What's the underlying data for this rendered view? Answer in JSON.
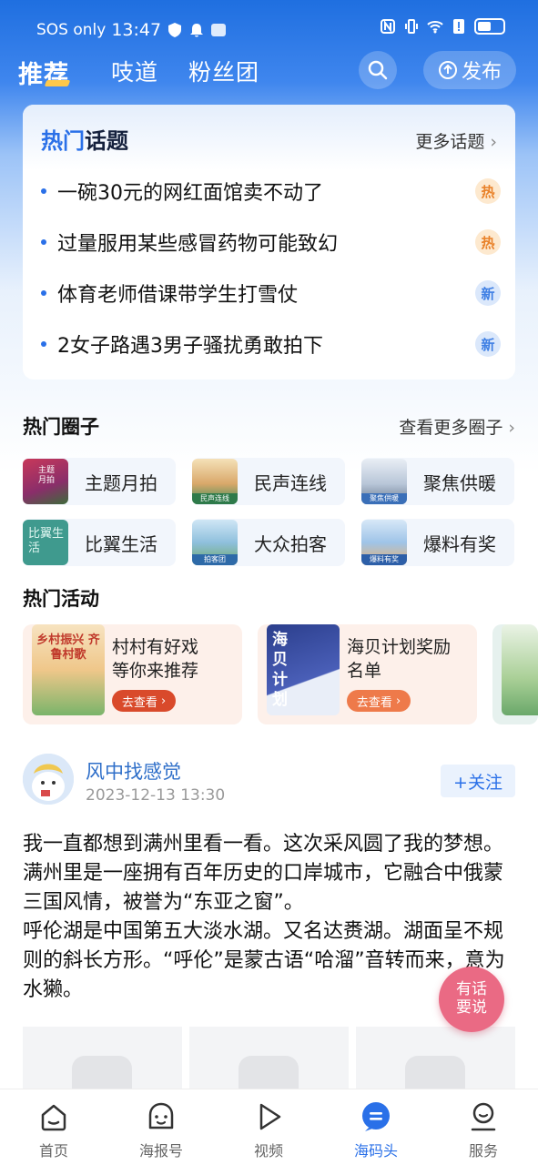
{
  "status_bar": {
    "carrier": "SOS only",
    "time": "13:47",
    "battery_level": 0.55
  },
  "nav": {
    "tabs": [
      {
        "label": "推荐",
        "active": true
      },
      {
        "label": "吱道",
        "active": false
      },
      {
        "label": "粉丝团",
        "active": false
      }
    ],
    "search_icon": "search-icon",
    "publish_label": "发布"
  },
  "hot_topics": {
    "title_highlight": "热门",
    "title_rest": "话题",
    "more_label": "更多话题",
    "items": [
      {
        "text": "一碗30元的网红面馆卖不动了",
        "badge": "热",
        "badge_type": "hot"
      },
      {
        "text": "过量服用某些感冒药物可能致幻",
        "badge": "热",
        "badge_type": "hot"
      },
      {
        "text": "体育老师借课带学生打雪仗",
        "badge": "新",
        "badge_type": "new"
      },
      {
        "text": "2女子路遇3男子骚扰勇敢拍下",
        "badge": "新",
        "badge_type": "new"
      }
    ]
  },
  "hot_circles": {
    "title": "热门圈子",
    "more_label": "查看更多圈子",
    "items": [
      {
        "label": "主题月拍",
        "thumb_text": "主题月拍"
      },
      {
        "label": "民声连线",
        "thumb_text": "民声连线"
      },
      {
        "label": "聚焦供暖",
        "thumb_text": "聚焦供暖"
      },
      {
        "label": "比翼生活",
        "thumb_text": "比翼生活"
      },
      {
        "label": "大众拍客",
        "thumb_text": "拍客团"
      },
      {
        "label": "爆料有奖",
        "thumb_text": "爆料有奖"
      }
    ]
  },
  "hot_activities": {
    "title": "热门活动",
    "items": [
      {
        "line1": "村村有好戏",
        "line2": "等你来推荐",
        "button": "去查看",
        "thumb_text": "乡村振兴 齐鲁村歌"
      },
      {
        "line1": "海贝计划奖励",
        "line2": "名单",
        "button": "去查看",
        "thumb_text": "海贝计划"
      }
    ]
  },
  "post": {
    "author": "风中找感觉",
    "time": "2023-12-13 13:30",
    "follow_label": "+关注",
    "body": "我一直都想到满州里看一看。这次采风圆了我的梦想。满州里是一座拥有百年历史的口岸城市，它融合中俄蒙三国风情，被誉为“东亚之窗”。\n呼伦湖是中国第五大淡水湖。又名达赉湖。湖面呈不规则的斜长方形。“呼伦”是蒙古语“哈溜”音转而来，意为水獭。"
  },
  "float_button": {
    "line1": "有话",
    "line2": "要说"
  },
  "tabbar": {
    "items": [
      {
        "label": "首页",
        "icon": "home-icon",
        "active": false
      },
      {
        "label": "海报号",
        "icon": "face-icon",
        "active": false
      },
      {
        "label": "视频",
        "icon": "play-icon",
        "active": false
      },
      {
        "label": "海码头",
        "icon": "chat-icon",
        "active": true
      },
      {
        "label": "服务",
        "icon": "user-icon",
        "active": false
      }
    ]
  }
}
